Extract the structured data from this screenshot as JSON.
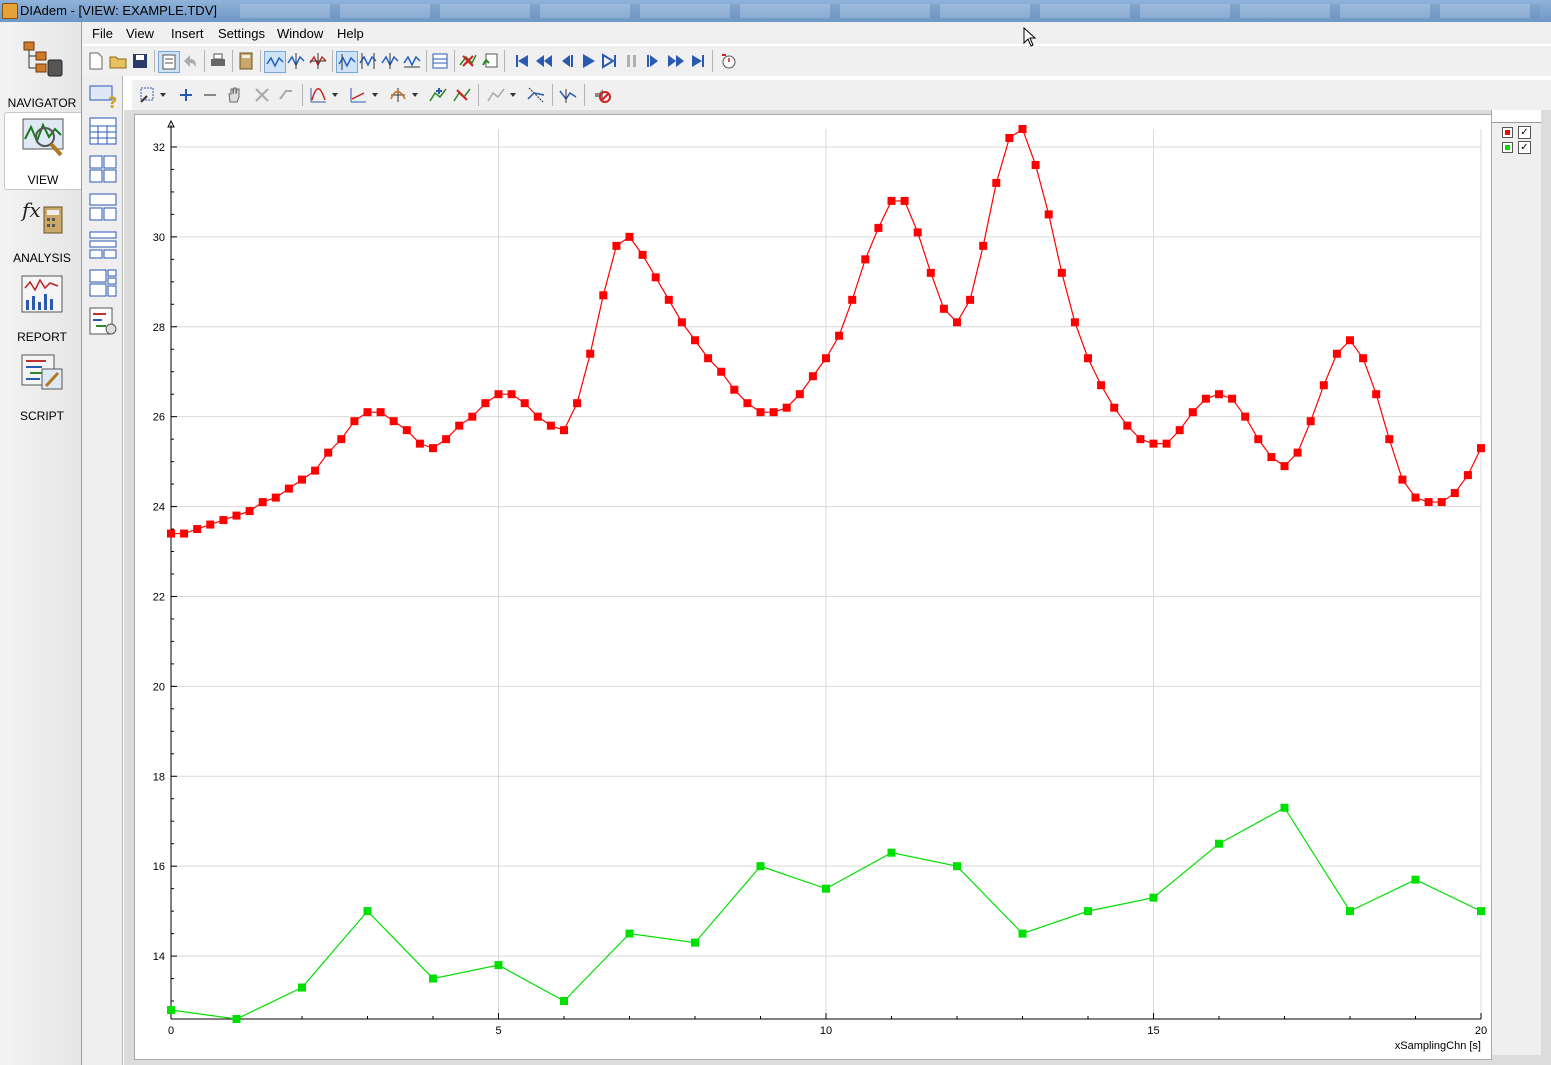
{
  "window": {
    "title": "DIAdem - [VIEW:   EXAMPLE.TDV]"
  },
  "menu": [
    "File",
    "View",
    "Insert",
    "Settings",
    "Window",
    "Help"
  ],
  "nav": {
    "items": [
      {
        "label": "NAVIGATOR",
        "icon": "navigator-icon",
        "active": false
      },
      {
        "label": "VIEW",
        "icon": "view-icon",
        "active": true
      },
      {
        "label": "ANALYSIS",
        "icon": "analysis-icon",
        "active": false
      },
      {
        "label": "REPORT",
        "icon": "report-icon",
        "active": false
      },
      {
        "label": "SCRIPT",
        "icon": "script-icon",
        "active": false
      }
    ]
  },
  "toolbar1_icons": [
    "new-file-icon",
    "open-file-icon",
    "save-icon",
    "properties-icon",
    "undo-icon",
    "print-icon",
    "calculator-icon",
    "cursor-mode-icon",
    "peak-cursor-icon",
    "crosshair-cursor-icon",
    "band-cursor-icon",
    "frame-cursor-icon",
    "flags-cursor-icon",
    "channel-table-icon",
    "delete-flags-icon",
    "copy-data-icon",
    "first-icon",
    "fast-back-icon",
    "step-back-icon",
    "play-icon",
    "play-step-icon",
    "pause-icon",
    "step-forward-icon",
    "fast-forward-icon",
    "last-icon",
    "timer-icon"
  ],
  "toolbar2_icons": [
    "zoom-fit-icon",
    "dropdown-icon",
    "zoom-in-icon",
    "zoom-out-icon",
    "pan-hand-icon",
    "zoom-reset-icon",
    "zoom-undo-icon",
    "curve-icon",
    "dropdown-icon",
    "axis-icon",
    "dropdown-icon",
    "scaling-icon",
    "dropdown-icon",
    "add-curve-icon",
    "remove-curve-icon",
    "overlay-icon",
    "dropdown-icon",
    "cursor-sync-icon",
    "marker-icon",
    "mute-icon"
  ],
  "colors": {
    "series1": "#ff0000",
    "series2": "#00e000",
    "grid": "#d9d9d9"
  },
  "chart_data": {
    "type": "line",
    "xlabel": "xSamplingChn [s]",
    "ylabel": "",
    "xlim": [
      0,
      20
    ],
    "ylim": [
      12.6,
      32.4
    ],
    "x_ticks": [
      0,
      5,
      10,
      15,
      20
    ],
    "y_ticks": [
      14,
      16,
      18,
      20,
      22,
      24,
      26,
      28,
      30,
      32
    ],
    "grid": true,
    "legend_position": "right",
    "series": [
      {
        "color": "#ff0000",
        "marker": "square",
        "x": [
          0,
          0.2,
          0.4,
          0.6,
          0.8,
          1.0,
          1.2,
          1.4,
          1.6,
          1.8,
          2.0,
          2.2,
          2.4,
          2.6,
          2.8,
          3.0,
          3.2,
          3.4,
          3.6,
          3.8,
          4.0,
          4.2,
          4.4,
          4.6,
          4.8,
          5.0,
          5.2,
          5.4,
          5.6,
          5.8,
          6.0,
          6.2,
          6.4,
          6.6,
          6.8,
          7.0,
          7.2,
          7.4,
          7.6,
          7.8,
          8.0,
          8.2,
          8.4,
          8.6,
          8.8,
          9.0,
          9.2,
          9.4,
          9.6,
          9.8,
          10.0,
          10.2,
          10.4,
          10.6,
          10.8,
          11.0,
          11.2,
          11.4,
          11.6,
          11.8,
          12.0,
          12.2,
          12.4,
          12.6,
          12.8,
          13.0,
          13.2,
          13.4,
          13.6,
          13.8,
          14.0,
          14.2,
          14.4,
          14.6,
          14.8,
          15.0,
          15.2,
          15.4,
          15.6,
          15.8,
          16.0,
          16.2,
          16.4,
          16.6,
          16.8,
          17.0,
          17.2,
          17.4,
          17.6,
          17.8,
          18.0,
          18.2,
          18.4,
          18.6,
          18.8,
          19.0,
          19.2,
          19.4,
          19.6,
          19.8,
          20.0
        ],
        "values": [
          23.4,
          23.4,
          23.5,
          23.6,
          23.7,
          23.8,
          23.9,
          24.1,
          24.2,
          24.4,
          24.6,
          24.8,
          25.2,
          25.5,
          25.9,
          26.1,
          26.1,
          25.9,
          25.7,
          25.4,
          25.3,
          25.5,
          25.8,
          26.0,
          26.3,
          26.5,
          26.5,
          26.3,
          26.0,
          25.8,
          25.7,
          26.3,
          27.4,
          28.7,
          29.8,
          30.0,
          29.6,
          29.1,
          28.6,
          28.1,
          27.7,
          27.3,
          27.0,
          26.6,
          26.3,
          26.1,
          26.1,
          26.2,
          26.5,
          26.9,
          27.3,
          27.8,
          28.6,
          29.5,
          30.2,
          30.8,
          30.8,
          30.1,
          29.2,
          28.4,
          28.1,
          28.6,
          29.8,
          31.2,
          32.2,
          32.4,
          31.6,
          30.5,
          29.2,
          28.1,
          27.3,
          26.7,
          26.2,
          25.8,
          25.5,
          25.4,
          25.4,
          25.7,
          26.1,
          26.4,
          26.5,
          26.4,
          26.0,
          25.5,
          25.1,
          24.9,
          25.2,
          25.9,
          26.7,
          27.4,
          27.7,
          27.3,
          26.5,
          25.5,
          24.6,
          24.2,
          24.1,
          24.1,
          24.3,
          24.7,
          25.3
        ]
      },
      {
        "color": "#00e000",
        "marker": "square",
        "x": [
          0,
          1,
          2,
          3,
          4,
          5,
          6,
          7,
          8,
          9,
          10,
          11,
          12,
          13,
          14,
          15,
          16,
          17,
          18,
          19,
          20
        ],
        "values": [
          12.8,
          12.6,
          13.3,
          15.0,
          13.5,
          13.8,
          13.0,
          14.5,
          14.3,
          16.0,
          15.5,
          16.3,
          16.0,
          14.5,
          15.0,
          15.3,
          16.5,
          17.3,
          15.0,
          15.7,
          15.0
        ]
      }
    ]
  }
}
